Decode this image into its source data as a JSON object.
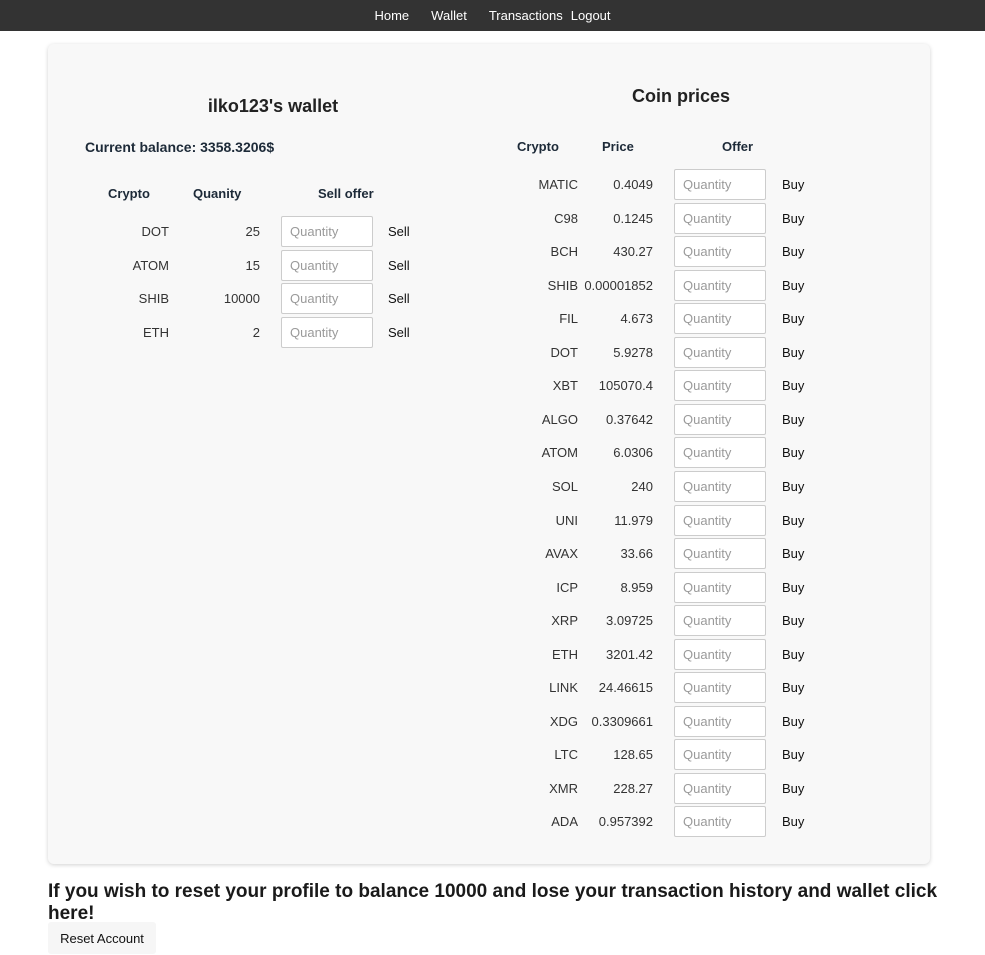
{
  "nav": {
    "items": [
      "Home",
      "Wallet",
      "Transactions",
      "Logout"
    ]
  },
  "wallet": {
    "title": "ilko123's wallet",
    "balance": "Current balance: 3358.3206$",
    "headers": {
      "crypto": "Crypto",
      "quantity": "Quanity",
      "offer": "Sell offer"
    },
    "placeholder": "Quantity",
    "action_label": "Sell",
    "rows": [
      {
        "symbol": "DOT",
        "quantity": "25"
      },
      {
        "symbol": "ATOM",
        "quantity": "15"
      },
      {
        "symbol": "SHIB",
        "quantity": "10000"
      },
      {
        "symbol": "ETH",
        "quantity": "2"
      }
    ]
  },
  "prices": {
    "title": "Coin prices",
    "headers": {
      "crypto": "Crypto",
      "price": "Price",
      "offer": "Offer"
    },
    "placeholder": "Quantity",
    "action_label": "Buy",
    "rows": [
      {
        "symbol": "MATIC",
        "price": "0.4049"
      },
      {
        "symbol": "C98",
        "price": "0.1245"
      },
      {
        "symbol": "BCH",
        "price": "430.27"
      },
      {
        "symbol": "SHIB",
        "price": "0.00001852"
      },
      {
        "symbol": "FIL",
        "price": "4.673"
      },
      {
        "symbol": "DOT",
        "price": "5.9278"
      },
      {
        "symbol": "XBT",
        "price": "105070.4"
      },
      {
        "symbol": "ALGO",
        "price": "0.37642"
      },
      {
        "symbol": "ATOM",
        "price": "6.0306"
      },
      {
        "symbol": "SOL",
        "price": "240"
      },
      {
        "symbol": "UNI",
        "price": "11.979"
      },
      {
        "symbol": "AVAX",
        "price": "33.66"
      },
      {
        "symbol": "ICP",
        "price": "8.959"
      },
      {
        "symbol": "XRP",
        "price": "3.09725"
      },
      {
        "symbol": "ETH",
        "price": "3201.42"
      },
      {
        "symbol": "LINK",
        "price": "24.46615"
      },
      {
        "symbol": "XDG",
        "price": "0.3309661"
      },
      {
        "symbol": "LTC",
        "price": "128.65"
      },
      {
        "symbol": "XMR",
        "price": "228.27"
      },
      {
        "symbol": "ADA",
        "price": "0.957392"
      }
    ]
  },
  "reset": {
    "message": "If you wish to reset your profile to balance 10000 and lose your transaction history and wallet click here!",
    "button_label": "Reset Account"
  }
}
